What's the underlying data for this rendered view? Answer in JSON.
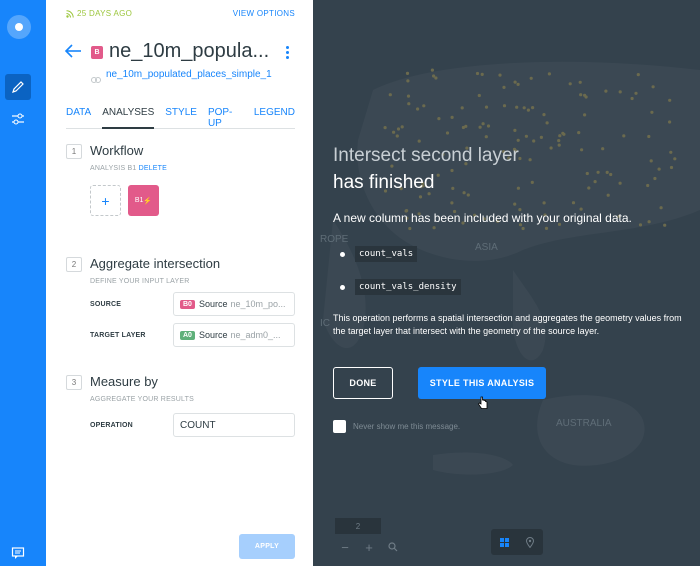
{
  "sidebar_left": {
    "icons": [
      "logo-icon",
      "pencil-icon",
      "sliders-icon",
      "chat-icon"
    ]
  },
  "panel": {
    "updated": "25 DAYS AGO",
    "view_options": "VIEW OPTIONS",
    "layer_badge": "B",
    "layer_title": "ne_10m_popula...",
    "layer_source": "ne_10m_populated_places_simple_1",
    "tabs": [
      {
        "label": "DATA"
      },
      {
        "label": "ANALYSES"
      },
      {
        "label": "STYLE"
      },
      {
        "label": "POP-UP"
      },
      {
        "label": "LEGEND"
      }
    ],
    "workflow": {
      "num": "1",
      "title": "Workflow",
      "sub": "ANALYSIS B1",
      "delete": "DELETE",
      "add_symbol": "+",
      "node_label": "B1"
    },
    "aggregate": {
      "num": "2",
      "title": "Aggregate intersection",
      "sub": "DEFINE YOUR INPUT LAYER",
      "source_label": "SOURCE",
      "source_badge": "B0",
      "source_text": "Source",
      "source_value": "ne_10m_po...",
      "target_label": "TARGET LAYER",
      "target_badge": "A0",
      "target_text": "Source",
      "target_value": "ne_adm0_..."
    },
    "measure": {
      "num": "3",
      "title": "Measure by",
      "sub": "AGGREGATE YOUR RESULTS",
      "operation_label": "OPERATION",
      "operation_value": "COUNT"
    },
    "apply": "APPLY"
  },
  "overlay": {
    "title_line1": "Intersect second layer",
    "title_line2": "has finished",
    "description": "A new column has been included with your original data.",
    "columns": [
      "count_vals",
      "count_vals_density"
    ],
    "paragraph": "This operation performs a spatial intersection and aggregates the geometry values from the target layer that intersect with the geometry of the source layer.",
    "done": "DONE",
    "style_this": "STYLE THIS ANALYSIS",
    "never_show": "Never show me this message."
  },
  "map": {
    "labels": [
      "ASIA",
      "AUSTRALIA",
      "ROPE",
      "IC"
    ],
    "zoom": "2",
    "zoom_in": "+",
    "zoom_out": "−"
  },
  "colors": {
    "brand": "#1785fb",
    "layer_pink": "#e25a8a",
    "source_b0": "#e25a8a",
    "target_a0": "#5fb07a",
    "map_bg": "#34424d"
  }
}
